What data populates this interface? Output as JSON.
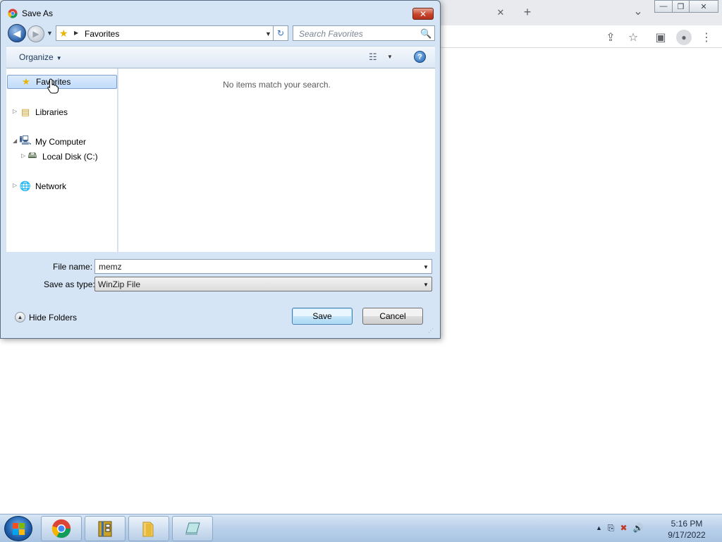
{
  "dialog": {
    "title": "Save As",
    "close_label": "✕",
    "address": {
      "location": "Favorites",
      "star_icon": "★",
      "crumb_arrow": "▶",
      "dropdown": "▼"
    },
    "search": {
      "placeholder": "Search Favorites",
      "icon": "🔍"
    },
    "nav": {
      "back": "◀",
      "forward": "▶",
      "recent": "▼",
      "refresh": "↻"
    },
    "commandbar": {
      "organize": "Organize",
      "organize_dd": "▼",
      "views_icon": "☷",
      "views_dd": "▼",
      "help": "?"
    },
    "tree": [
      {
        "label": "Favorites",
        "icon": "★",
        "arrow": "",
        "selected": true
      },
      {
        "label": "Libraries",
        "icon": "▤",
        "arrow": "▷"
      },
      {
        "label": "My Computer",
        "icon": "🖳",
        "arrow": "◢"
      },
      {
        "label": "Local Disk (C:)",
        "icon": "🖴",
        "arrow": "▷"
      },
      {
        "label": "Network",
        "icon": "🌐",
        "arrow": "▷"
      }
    ],
    "empty_message": "No items match your search.",
    "filename_label": "File name:",
    "filename_value": "memz",
    "savetype_label": "Save as type:",
    "savetype_value": "WinZip File",
    "hide_folders": "Hide Folders",
    "save_button": "Save",
    "cancel_button": "Cancel"
  },
  "browser": {
    "tab_close": "✕",
    "new_tab": "+",
    "tab_list": "⌄",
    "window_controls": [
      "—",
      "❐",
      "✕"
    ],
    "toolbar_icons": [
      "⇪",
      "☆",
      "▣",
      "●",
      "⋮"
    ]
  },
  "taskbar": {
    "tray_icons": [
      "▲",
      "⎘",
      "✖",
      "🔊"
    ],
    "time": "5:16 PM",
    "date": "9/17/2022"
  },
  "colors": {
    "dialog_frame": "#d6e5f5",
    "selection": "#c1dbfc",
    "taskbar": "#b9d0ea",
    "accent": "#3c7fb1"
  }
}
